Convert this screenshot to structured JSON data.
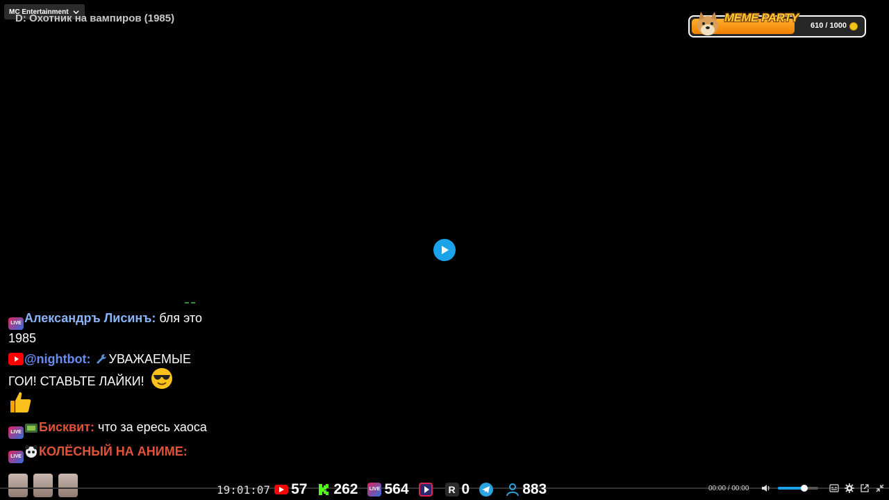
{
  "channel": {
    "name": "MC Entertainment"
  },
  "video": {
    "title": "D: Охотник на вампиров (1985)"
  },
  "meme_party": {
    "title": "MEME PARTY",
    "progress": 0.61,
    "count_text": "610 / 1000"
  },
  "chat": {
    "messages": [
      {
        "platform": "live",
        "author": "Александръ Лисинъ:",
        "author_color": "#8ab4f8",
        "text": " бля это 1985"
      },
      {
        "platform": "youtube",
        "author": "@nightbot:",
        "author_color": "#6a8cf0",
        "text": "УВАЖАЕМЫЕ ГОИ! СТАВЬТЕ ЛАЙКИ!"
      },
      {
        "platform": "live",
        "author": "Бисквит:",
        "author_color": "#e0533a",
        "text": " что за ересь хаоса"
      },
      {
        "platform": "live",
        "author": "КОЛЁСНЫЙ НА АНИМЕ:",
        "author_color": "#e0533a",
        "text": ""
      }
    ]
  },
  "stats": {
    "clock": "19:01:07",
    "youtube": "57",
    "kick": "262",
    "vk_live": "564",
    "rutube": "",
    "r_platform": "0",
    "telegram": "",
    "viewers": "883"
  },
  "player": {
    "time_current": "00:00",
    "time_separator": "/",
    "time_total": "00:00",
    "volume": 0.65
  },
  "icons": {
    "chat_live_badge": "LIVE",
    "vk_live_badge": "LIVE",
    "r_platform_letter": "R"
  }
}
